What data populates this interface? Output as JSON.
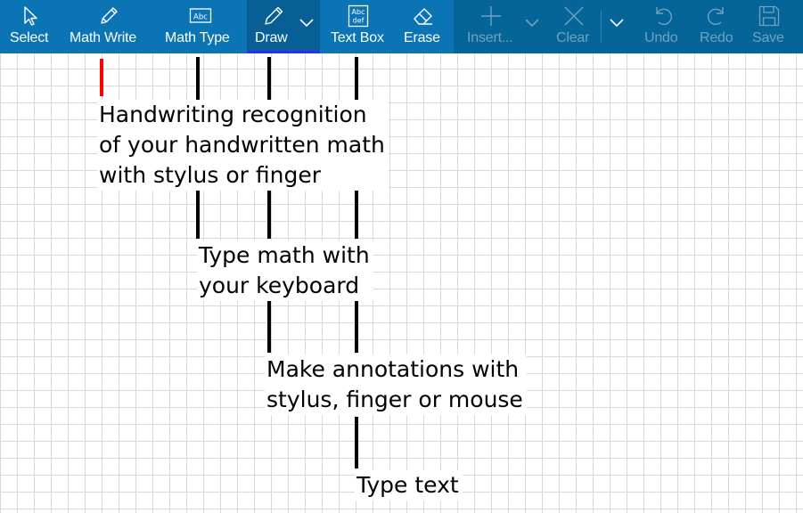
{
  "toolbar": {
    "select": "Select",
    "math_write": "Math Write",
    "math_type": "Math Type",
    "draw": "Draw",
    "text_box": "Text Box",
    "erase": "Erase",
    "insert": "Insert...",
    "clear": "Clear",
    "undo": "Undo",
    "redo": "Redo",
    "save": "Save",
    "math_type_icon_text": "Abc",
    "text_box_icon_line1": "Abc",
    "text_box_icon_line2": "def"
  },
  "callouts": {
    "math_write": "Handwriting recognition\nof your handwritten math\nwith stylus or finger",
    "math_type": "Type math with\nyour keyboard",
    "draw": "Make annotations with\nstylus, finger or mouse",
    "text_box": "Type text"
  },
  "colors": {
    "toolbar_bg": "#0a74b4",
    "toolbar_right_bg": "#066598",
    "active_underline": "#2b2bff",
    "cursor_red": "#ff0000",
    "grid_line": "#d9d9d9"
  },
  "icons": {
    "select": "cursor-arrow-icon",
    "math_write": "pencil-icon",
    "math_type": "keyboard-abc-icon",
    "draw": "pen-icon",
    "text_box": "text-box-icon",
    "erase": "eraser-icon",
    "insert": "plus-icon",
    "clear": "close-x-icon",
    "undo": "undo-icon",
    "redo": "redo-icon",
    "save": "floppy-disk-icon"
  }
}
